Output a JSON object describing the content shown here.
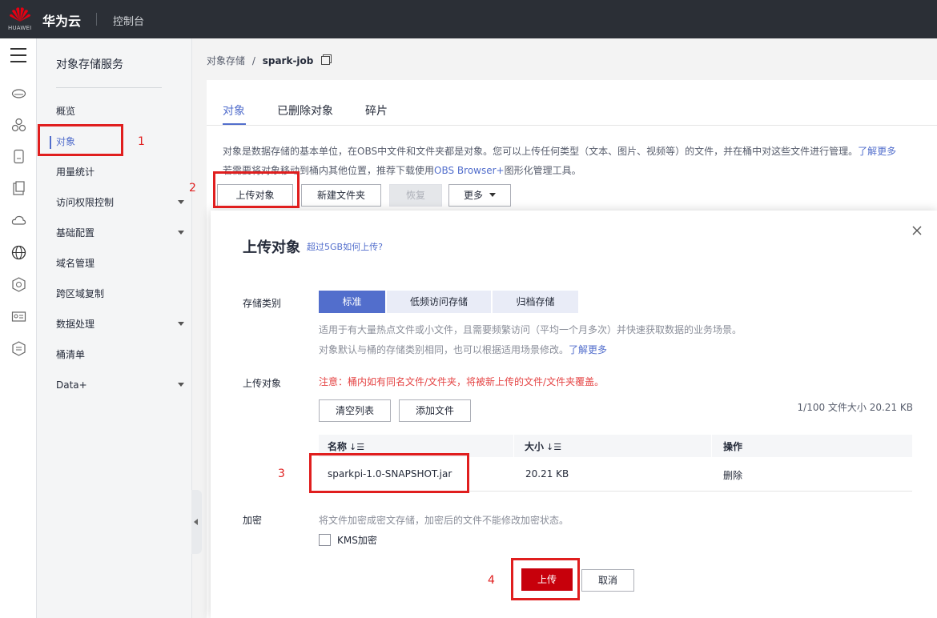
{
  "topbar": {
    "logo_text": "HUAWEI",
    "brand": "华为云",
    "console": "控制台"
  },
  "sidebar": {
    "title": "对象存储服务",
    "items": [
      {
        "label": "概览",
        "has_caret": false
      },
      {
        "label": "对象",
        "has_caret": false
      },
      {
        "label": "用量统计",
        "has_caret": false
      },
      {
        "label": "访问权限控制",
        "has_caret": true
      },
      {
        "label": "基础配置",
        "has_caret": true
      },
      {
        "label": "域名管理",
        "has_caret": false
      },
      {
        "label": "跨区域复制",
        "has_caret": false
      },
      {
        "label": "数据处理",
        "has_caret": true
      },
      {
        "label": "桶清单",
        "has_caret": false
      },
      {
        "label": "Data+",
        "has_caret": true
      }
    ]
  },
  "breadcrumb": {
    "root": "对象存储",
    "sep": "/",
    "current": "spark-job"
  },
  "tabs": [
    {
      "label": "对象"
    },
    {
      "label": "已删除对象"
    },
    {
      "label": "碎片"
    }
  ],
  "description": {
    "line1": "对象是数据存储的基本单位，在OBS中文件和文件夹都是对象。您可以上传任何类型（文本、图片、视频等）的文件，并在桶中对这些文件进行管理。",
    "line1_link": "了解更多",
    "line2_prefix": "若需要将对象移动到桶内其他位置，推荐下载使用",
    "line2_link": "OBS Browser+",
    "line2_suffix": "图形化管理工具。"
  },
  "toolbar": {
    "upload": "上传对象",
    "new_folder": "新建文件夹",
    "restore": "恢复",
    "more": "更多"
  },
  "modal": {
    "title": "上传对象",
    "title_link": "超过5GB如何上传?",
    "storage_label": "存储类别",
    "storage_options": [
      "标准",
      "低频访问存储",
      "归档存储"
    ],
    "storage_hint1": "适用于有大量热点文件或小文件，且需要频繁访问（平均一个月多次）并快速获取数据的业务场景。",
    "storage_hint2": "对象默认与桶的存储类别相同，也可以根据适用场景修改。",
    "storage_hint2_link": "了解更多",
    "upload_label": "上传对象",
    "warning": "注意：桶内如有同名文件/文件夹，将被新上传的文件/文件夹覆盖。",
    "clear_list": "清空列表",
    "add_file": "添加文件",
    "count_text": "1/100 文件大小 20.21 KB",
    "table": {
      "headers": {
        "name": "名称",
        "size": "大小",
        "action": "操作"
      },
      "sort_glyph": "↓☰",
      "rows": [
        {
          "name": "sparkpi-1.0-SNAPSHOT.jar",
          "size": "20.21 KB",
          "action": "删除"
        }
      ]
    },
    "encrypt_label": "加密",
    "encrypt_hint": "将文件加密成密文存储，加密后的文件不能修改加密状态。",
    "kms_label": "KMS加密",
    "kms_checked": false,
    "submit": "上传",
    "cancel": "取消"
  },
  "annotations": [
    "1",
    "2",
    "3",
    "4"
  ],
  "colors": {
    "brand_red": "#c7000b",
    "accent_blue": "#526ecc",
    "annotation_red": "#e01e1e",
    "topbar": "#2b2f36"
  }
}
